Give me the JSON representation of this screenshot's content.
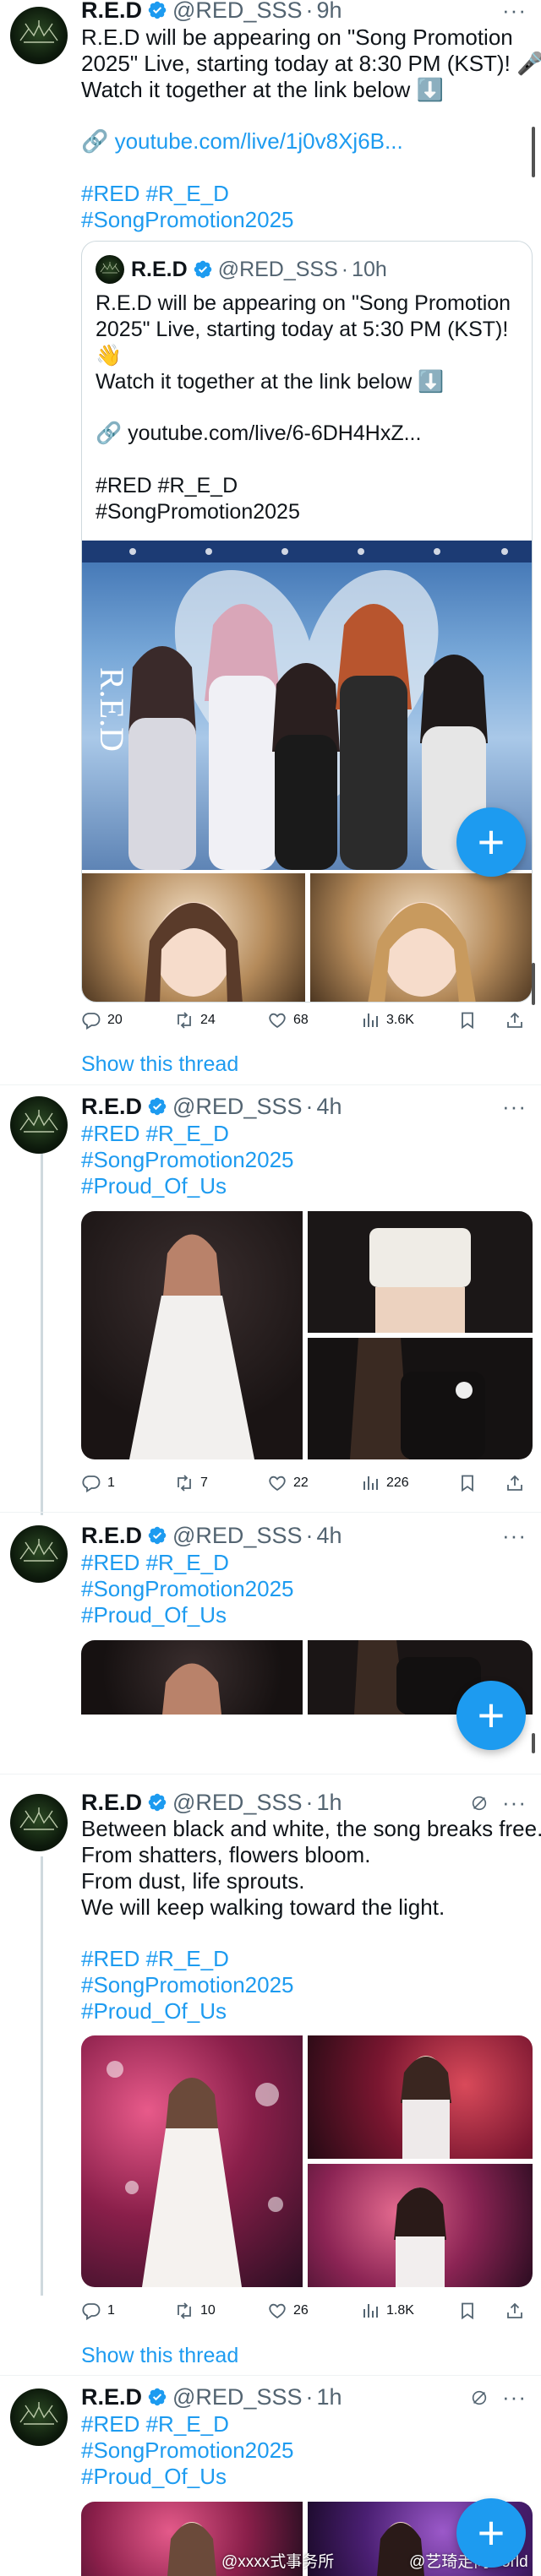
{
  "tweet1": {
    "name": "R.E.D",
    "handle": "@RED_SSS",
    "sep": "·",
    "time": "9h",
    "more": "···",
    "text_line1": "R.E.D will be appearing on \"Song Promotion",
    "text_line2": "2025\" Live, starting today at 8:30 PM (KST)! 🎤",
    "text_line3": "Watch it together at the link below ⬇️",
    "link": "🔗 youtube.com/live/1j0v8Xj6B...",
    "tags_line1": "#RED #R_E_D",
    "tags_line2": "#SongPromotion2025",
    "quote": {
      "name": "R.E.D",
      "handle": "@RED_SSS",
      "sep": "·",
      "time": "10h",
      "text_line1": "R.E.D will be appearing on \"Song Promotion",
      "text_line2": "2025\" Live, starting today at 5:30 PM (KST)!",
      "text_line3": "👋",
      "text_line4": "Watch it together at the link below ⬇️",
      "link": "🔗 youtube.com/live/6-6DH4HxZ...",
      "tags_line1": "#RED #R_E_D",
      "tags_line2": "#SongPromotion2025"
    },
    "actions": {
      "replies": "20",
      "retweets": "24",
      "likes": "68",
      "views": "3.6K"
    },
    "show_thread": "Show this thread"
  },
  "tweet2": {
    "name": "R.E.D",
    "handle": "@RED_SSS",
    "sep": "·",
    "time": "4h",
    "more": "···",
    "tags_line1": "#RED #R_E_D",
    "tags_line2": "#SongPromotion2025",
    "tags_line3": "#Proud_Of_Us",
    "actions": {
      "replies": "1",
      "retweets": "7",
      "likes": "22",
      "views": "226"
    }
  },
  "tweet3": {
    "name": "R.E.D",
    "handle": "@RED_SSS",
    "sep": "·",
    "time": "4h",
    "more": "···",
    "tags_line1": "#RED #R_E_D",
    "tags_line2": "#SongPromotion2025",
    "tags_line3": "#Proud_Of_Us"
  },
  "tweet4": {
    "name": "R.E.D",
    "handle": "@RED_SSS",
    "sep": "·",
    "time": "1h",
    "more": "···",
    "text_line1": "Between black and white, the song breaks free.",
    "text_line2": "From shatters, flowers bloom.",
    "text_line3": "From dust, life sprouts.",
    "text_line4": "We will keep walking toward the light.",
    "tags_line1": "#RED #R_E_D",
    "tags_line2": "#SongPromotion2025",
    "tags_line3": "#Proud_Of_Us",
    "actions": {
      "replies": "1",
      "retweets": "10",
      "likes": "26",
      "views": "1.8K"
    },
    "show_thread": "Show this thread"
  },
  "tweet5": {
    "name": "R.E.D",
    "handle": "@RED_SSS",
    "sep": "·",
    "time": "1h",
    "more": "···",
    "tags_line1": "#RED #R_E_D",
    "tags_line2": "#SongPromotion2025",
    "tags_line3": "#Proud_Of_Us"
  },
  "fab": {
    "label": "+"
  },
  "watermark": {
    "left": "@xxxx式事务所",
    "right": "@艺琦走向world"
  },
  "image_logo_text": "R.E.D",
  "colors": {
    "link": "#1d9bf0",
    "text": "#0f1419",
    "secondary": "#536471",
    "verified": "#1d9bf0",
    "border": "#cfd9de"
  },
  "icons": {
    "reply": "reply-icon",
    "retweet": "retweet-icon",
    "like": "heart-icon",
    "views": "views-icon",
    "bookmark": "bookmark-icon",
    "share": "share-icon",
    "grok": "grok-icon",
    "verified": "verified-badge-icon",
    "compose": "plus-icon"
  }
}
